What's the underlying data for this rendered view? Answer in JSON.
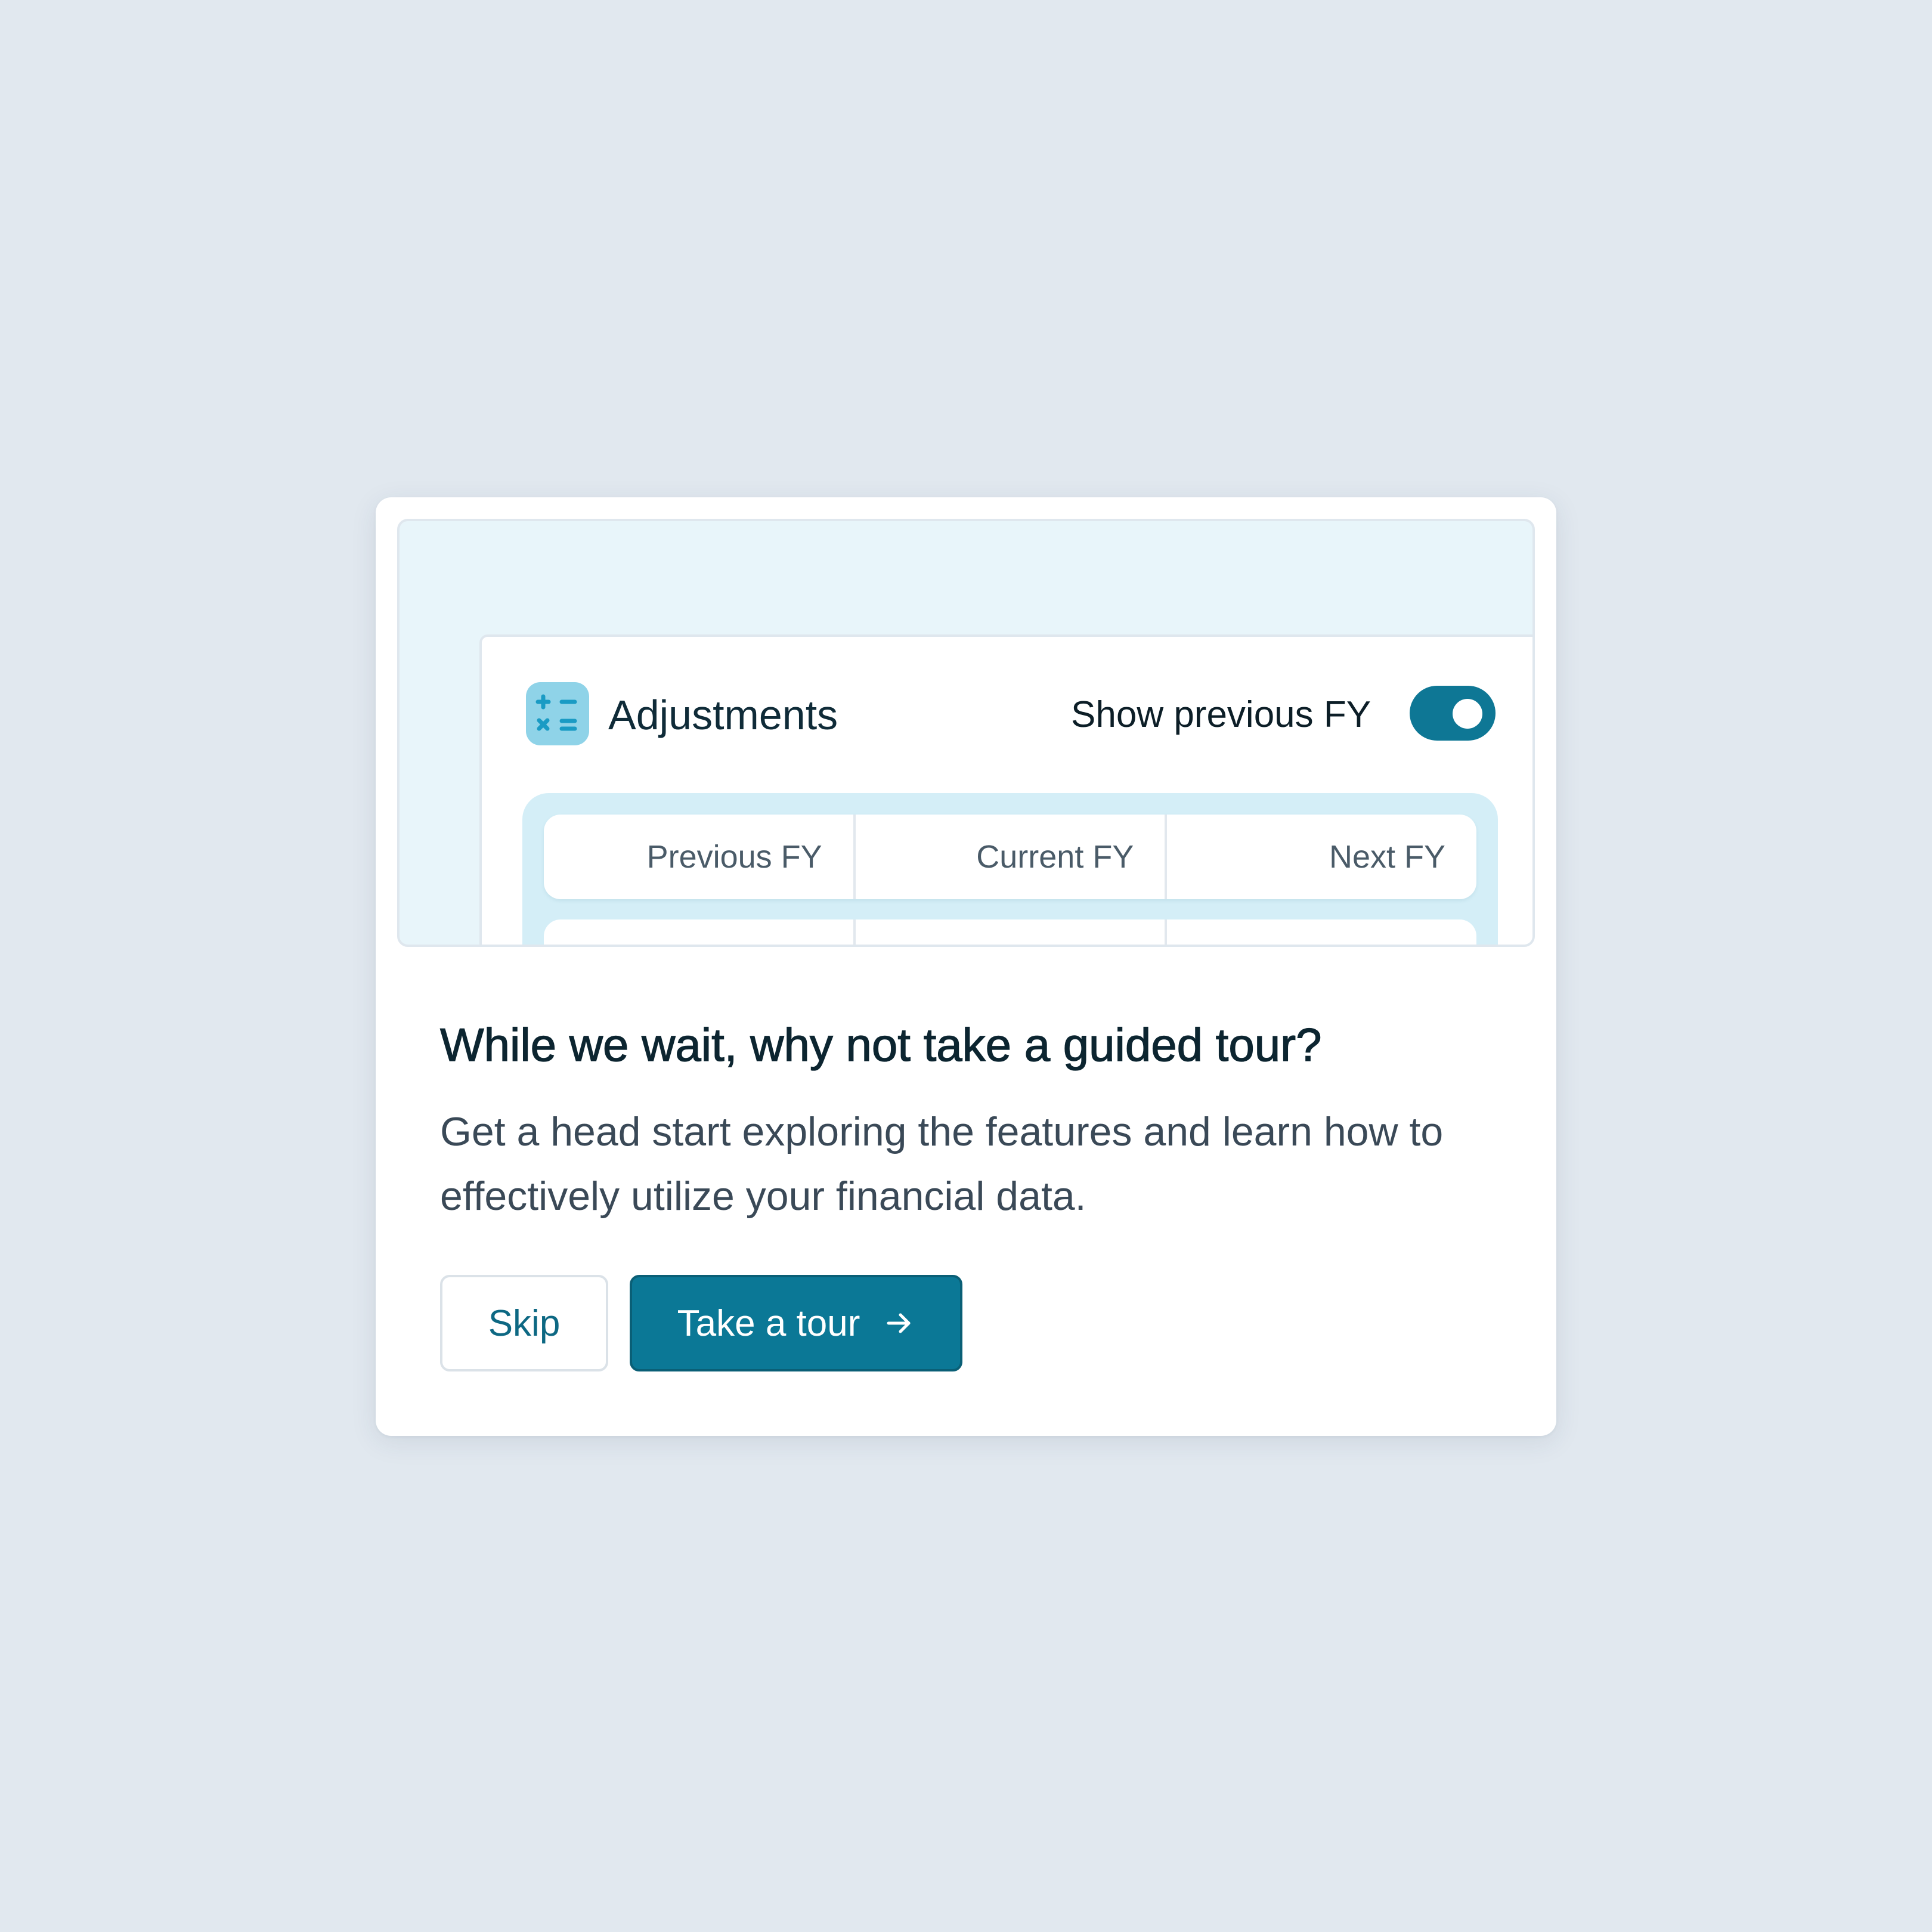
{
  "preview": {
    "panel_title": "Adjustments",
    "toggle_label": "Show previous FY",
    "toggle_on": true,
    "icon": "calculator-icon",
    "columns": [
      "Previous FY",
      "Current FY",
      "Next FY"
    ]
  },
  "dialog": {
    "heading": "While we wait, why not take a guided tour?",
    "body": "Get a head start exploring the features and learn how to effectively utilize your financial data."
  },
  "buttons": {
    "skip_label": "Skip",
    "tour_label": "Take a tour",
    "tour_icon": "arrow-right-icon"
  },
  "colors": {
    "accent": "#0b7896",
    "background": "#e1e8ef",
    "preview_background": "#e8f5fa",
    "icon_tile": "#8fd3e8"
  }
}
